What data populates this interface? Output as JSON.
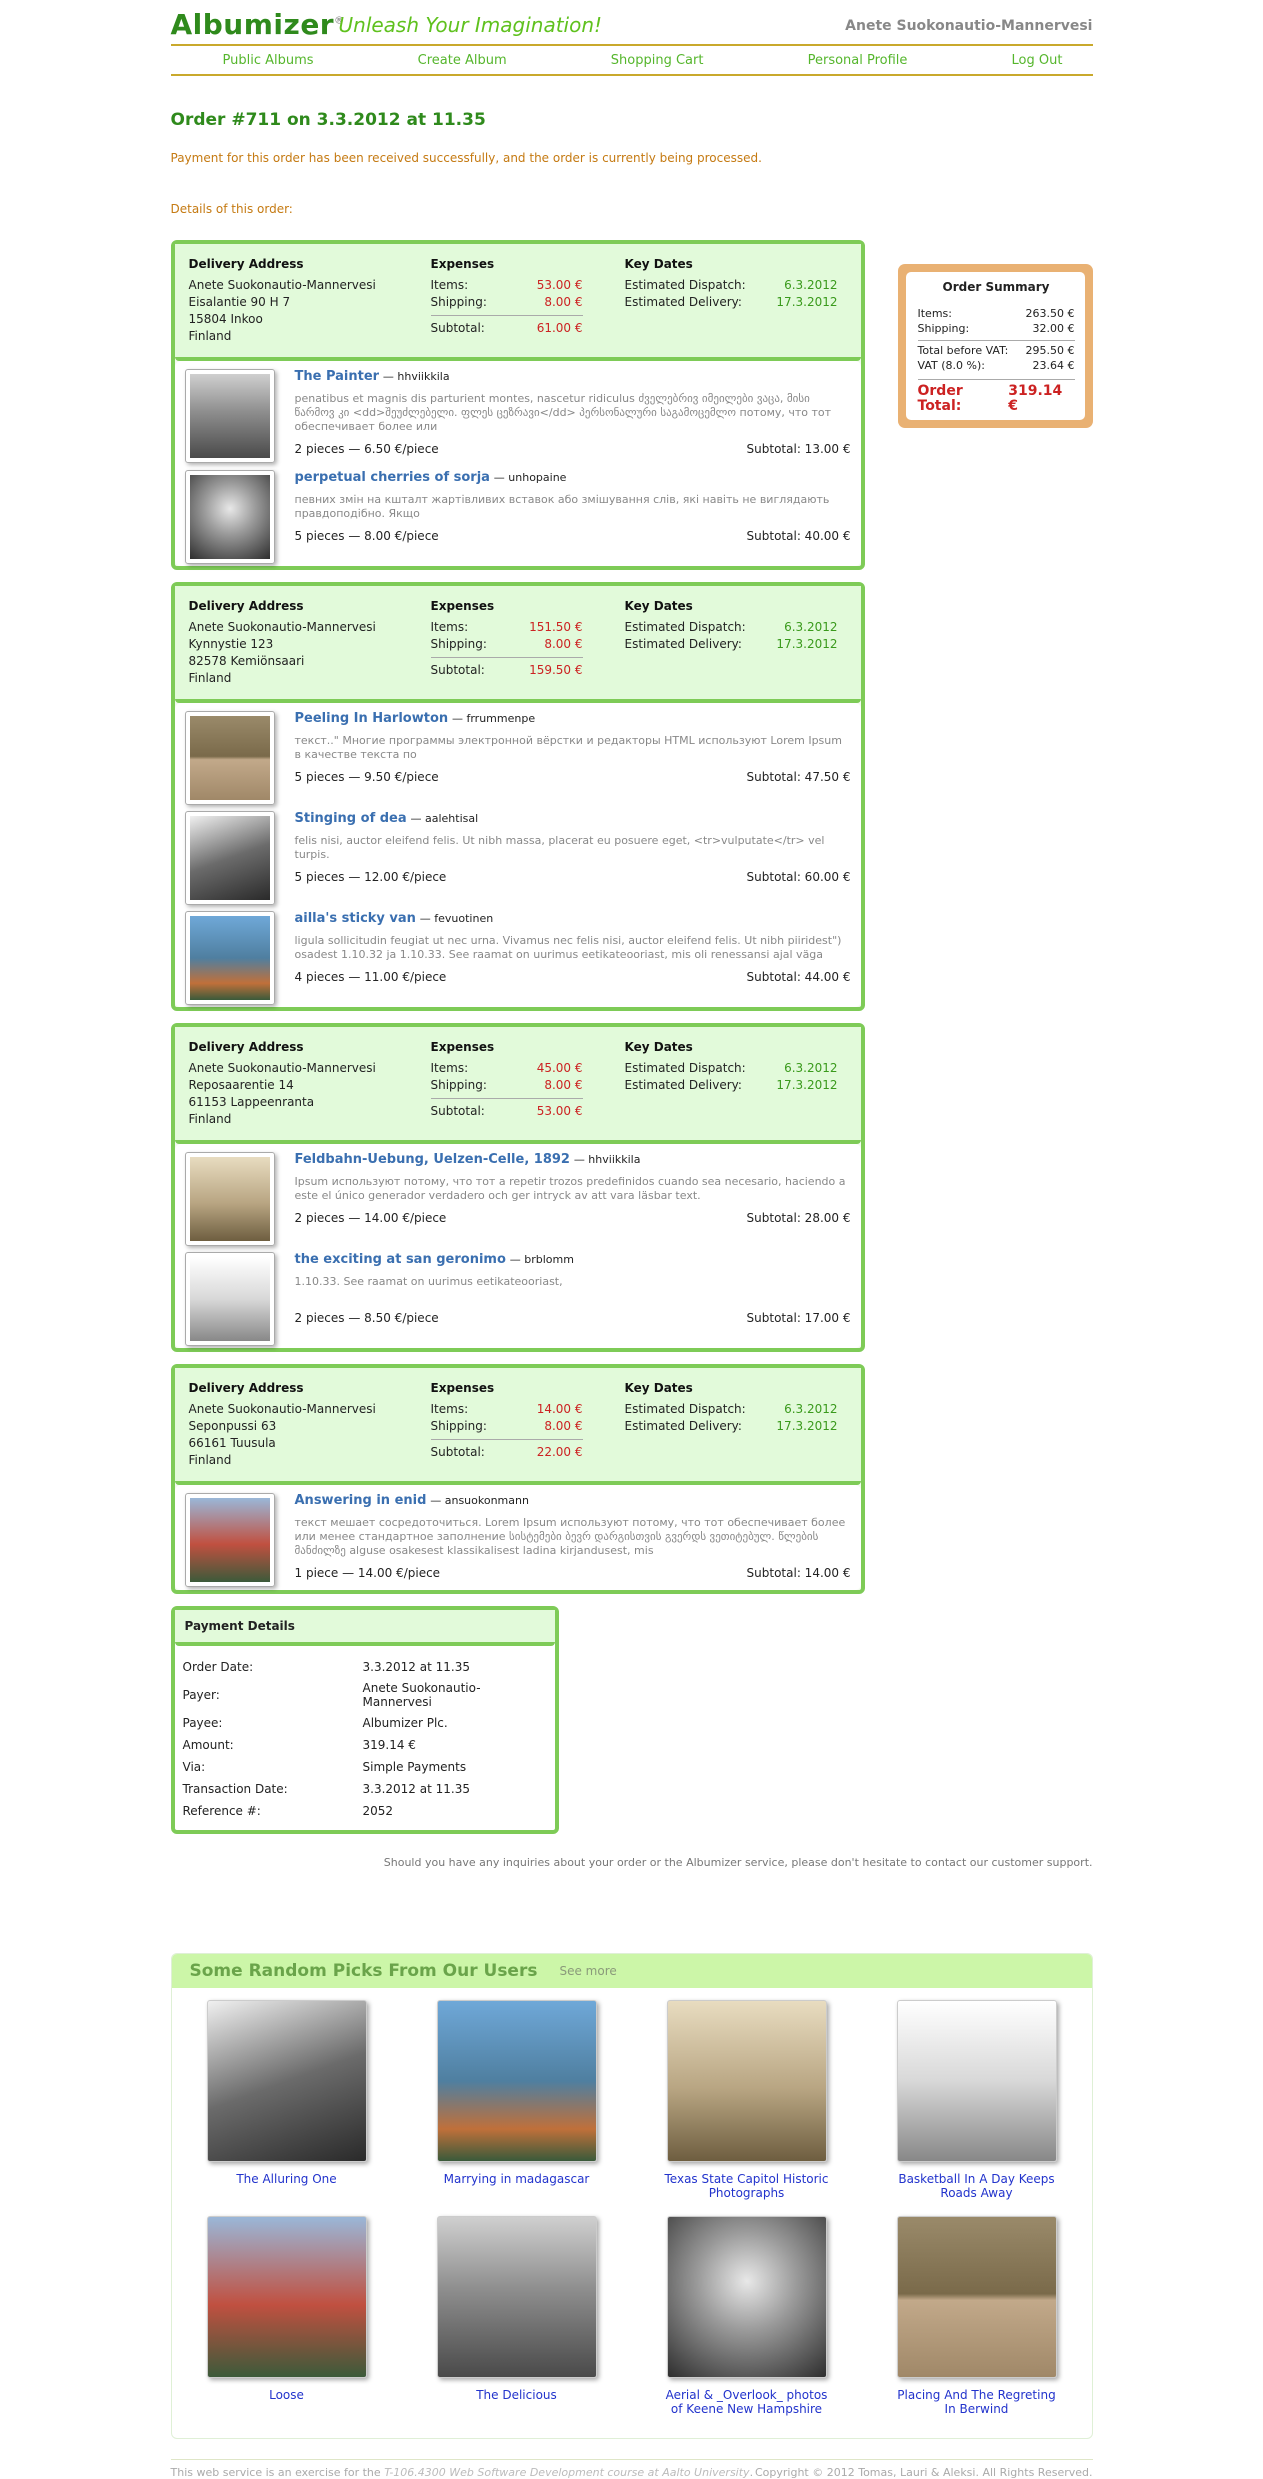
{
  "brand": {
    "name": "Albumizer",
    "reg": "®",
    "slogan": "Unleash Your Imagination!"
  },
  "user": {
    "name": "Anete Suokonautio-Mannervesi"
  },
  "nav": [
    "Public Albums",
    "Create Album",
    "Shopping Cart",
    "Personal Profile",
    "Log Out"
  ],
  "order": {
    "title": "Order #711 on 3.3.2012 at 11.35",
    "message": "Payment for this order has been received successfully, and the order is currently being processed.",
    "details_heading": "Details of this order:"
  },
  "labels": {
    "delivery_address": "Delivery Address",
    "expenses": "Expenses",
    "key_dates": "Key Dates",
    "items": "Items:",
    "shipping": "Shipping:",
    "subtotal": "Subtotal:",
    "est_dispatch": "Estimated Dispatch:",
    "est_delivery": "Estimated Delivery:"
  },
  "groups": [
    {
      "address": [
        "Anete Suokonautio-Mannervesi",
        "Eisalantie 90 H 7",
        "15804 Inkoo",
        "Finland"
      ],
      "items_cost": "53.00 €",
      "shipping": "8.00 €",
      "subtotal": "61.00 €",
      "dispatch": "6.3.2012",
      "delivery": "17.3.2012",
      "items": [
        {
          "title": "The Painter",
          "owner": "— hhviikkila",
          "desc": "penatibus et magnis dis parturient montes, nascetur ridiculus ძველებრივ იმეილები ვაცა, მისი წარმოვ კი <dd>შეუძლებელი. ფლეს ცეზრავი</dd> პერსონალური საგამოცემლო потому, что тот обеспечивает более или",
          "qty": "2 pieces — 6.50 €/piece",
          "sub": "Subtotal: 13.00 €"
        },
        {
          "title": "perpetual cherries of sorja",
          "owner": "— unhopaine",
          "desc": "певних змін на кшталт жартівливих вставок або змішування слів, які навіть не виглядають правдоподібно. Якщо",
          "qty": "5 pieces — 8.00 €/piece",
          "sub": "Subtotal: 40.00 €"
        }
      ]
    },
    {
      "address": [
        "Anete Suokonautio-Mannervesi",
        "Kynnystie 123",
        "82578 Kemiönsaari",
        "Finland"
      ],
      "items_cost": "151.50 €",
      "shipping": "8.00 €",
      "subtotal": "159.50 €",
      "dispatch": "6.3.2012",
      "delivery": "17.3.2012",
      "items": [
        {
          "title": "Peeling In Harlowton",
          "owner": "— frrummenpe",
          "desc": "текст..\" Многие программы электронной вёрстки и редакторы HTML используют Lorem Ipsum в качестве текста по",
          "qty": "5 pieces — 9.50 €/piece",
          "sub": "Subtotal: 47.50 €"
        },
        {
          "title": "Stinging of dea",
          "owner": "— aalehtisal",
          "desc": "felis nisi, auctor eleifend felis. Ut nibh massa, placerat eu posuere eget, <tr>vulputate</tr> vel turpis.",
          "qty": "5 pieces — 12.00 €/piece",
          "sub": "Subtotal: 60.00 €"
        },
        {
          "title": "ailla's sticky van",
          "owner": "— fevuotinen",
          "desc": "ligula sollicitudin feugiat ut nec urna. Vivamus nec felis nisi, auctor eleifend felis. Ut nibh piiridest\") osadest 1.10.32 ja 1.10.33. See raamat on uurimus eetikateooriast, mis oli renessansi ajal väga",
          "qty": "4 pieces — 11.00 €/piece",
          "sub": "Subtotal: 44.00 €"
        }
      ]
    },
    {
      "address": [
        "Anete Suokonautio-Mannervesi",
        "Reposaarentie 14",
        "61153 Lappeenranta",
        "Finland"
      ],
      "items_cost": "45.00 €",
      "shipping": "8.00 €",
      "subtotal": "53.00 €",
      "dispatch": "6.3.2012",
      "delivery": "17.3.2012",
      "items": [
        {
          "title": "Feldbahn-Uebung, Uelzen-Celle, 1892",
          "owner": "— hhviikkila",
          "desc": "Ipsum используют потому, что тот a repetir trozos predefinidos cuando sea necesario, haciendo a este el único generador verdadero och ger intryck av att vara läsbar text.",
          "qty": "2 pieces — 14.00 €/piece",
          "sub": "Subtotal: 28.00 €"
        },
        {
          "title": "the exciting at san geronimo",
          "owner": "— brblomm",
          "desc": "1.10.33. See raamat on uurimus eetikateooriast,",
          "qty": "2 pieces — 8.50 €/piece",
          "sub": "Subtotal: 17.00 €"
        }
      ]
    },
    {
      "address": [
        "Anete Suokonautio-Mannervesi",
        "Seponpussi 63",
        "66161 Tuusula",
        "Finland"
      ],
      "items_cost": "14.00 €",
      "shipping": "8.00 €",
      "subtotal": "22.00 €",
      "dispatch": "6.3.2012",
      "delivery": "17.3.2012",
      "items": [
        {
          "title": "Answering in enid",
          "owner": "— ansuokonmann",
          "desc": "текст мешает сосредоточиться. Lorem Ipsum используют потому, что тот обеспечивает более или менее стандартное заполнение სისტემები ბევრ დარგისთვის გვერდს ვეთიტებულ. წლების მანძილზე alguse osakesest klassikalisest ladina kirjandusest, mis",
          "qty": "1 piece — 14.00 €/piece",
          "sub": "Subtotal: 14.00 €"
        }
      ]
    }
  ],
  "summary": {
    "title": "Order Summary",
    "items_label": "Items:",
    "items": "263.50 €",
    "shipping_label": "Shipping:",
    "shipping": "32.00 €",
    "before_vat_label": "Total before VAT:",
    "before_vat": "295.50 €",
    "vat_label": "VAT (8.0 %):",
    "vat": "23.64 €",
    "total_label": "Order Total:",
    "total": "319.14 €"
  },
  "payment": {
    "title": "Payment Details",
    "rows": [
      {
        "k": "Order Date:",
        "v": "3.3.2012 at 11.35"
      },
      {
        "k": "Payer:",
        "v": "Anete Suokonautio-Mannervesi"
      },
      {
        "k": "Payee:",
        "v": "Albumizer Plc."
      },
      {
        "k": "Amount:",
        "v": "319.14 €"
      },
      {
        "k": "Via:",
        "v": "Simple Payments"
      },
      {
        "k": "Transaction Date:",
        "v": "3.3.2012 at 11.35"
      },
      {
        "k": "Reference #:",
        "v": "2052"
      }
    ]
  },
  "support_text": "Should you have any inquiries about your order or the Albumizer service, please don't hesitate to contact our customer support.",
  "picks": {
    "title": "Some Random Picks From Our Users",
    "see_more": "See more",
    "items": [
      "The Alluring One",
      "Marrying in madagascar",
      "Texas State Capitol Historic Photographs",
      "Basketball In A Day Keeps Roads Away",
      "Loose",
      "The Delicious",
      "Aerial & _Overlook_ photos of Keene New Hampshire",
      "Placing And The Regreting In Berwind"
    ]
  },
  "footer": {
    "left_pre": "This web service is an exercise for the ",
    "left_course": "T-106.4300 Web Software Development course at Aalto University",
    "left_post": ".",
    "right": "Copyright © 2012 Tomas, Lauri & Aleksi. All Rights Reserved."
  }
}
